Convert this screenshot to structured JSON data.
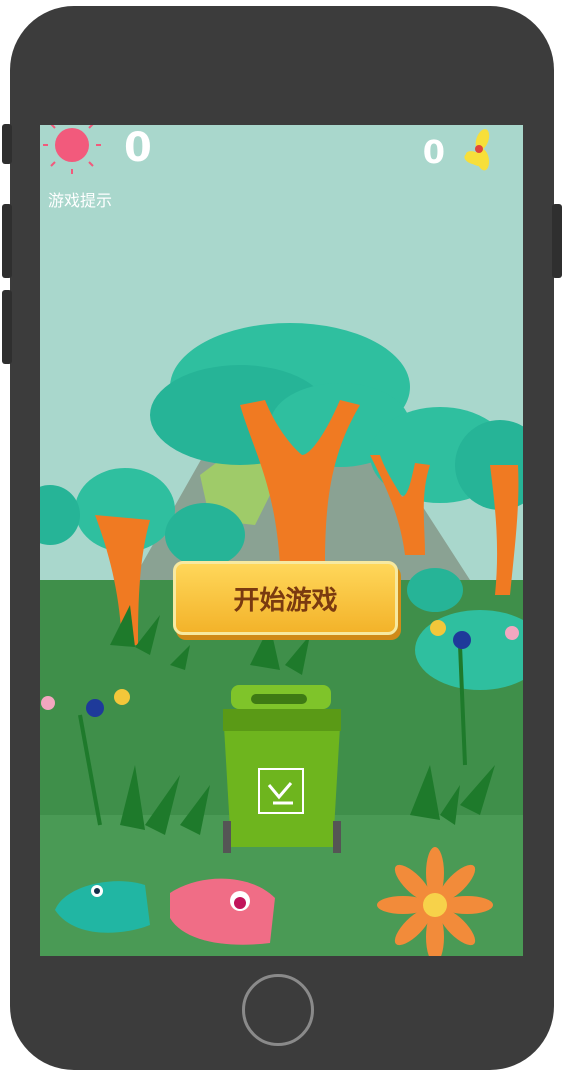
{
  "hud": {
    "score_value": "0",
    "collected_value": "0",
    "hint_label": "游戏提示",
    "score_icon": "sun-icon",
    "collected_icon": "flower-icon"
  },
  "start": {
    "label": "开始游戏"
  },
  "colors": {
    "sky": "#a9d7cc",
    "grass": "#3f8f4a",
    "button": "#f3b32a",
    "button_text": "#7a3a10"
  },
  "items": {
    "bin_icon": "green-trash-bin",
    "fish_1": "teal-fish",
    "fish_2": "pink-fish",
    "flower": "orange-flower"
  }
}
